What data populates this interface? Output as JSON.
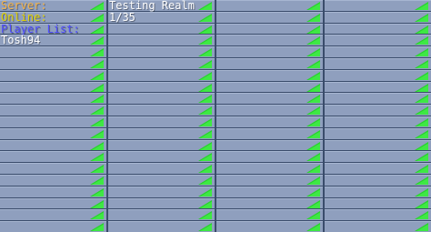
{
  "tab_list": {
    "server_label": "Server:",
    "server_value": "Testing Realm",
    "online_label": "Online:",
    "online_value": "1/35",
    "player_list_label": "Player List:",
    "players": [
      "Tosh94"
    ]
  },
  "colors": {
    "background": "#3f5273",
    "slot": "#8f9fbe",
    "server_label": "#f3b34b",
    "online_label": "#e4d400",
    "player_list_label": "#4e4cff",
    "text": "#ffffff",
    "signal": "#27d22b"
  },
  "icons": {
    "signal": "ping-signal-icon"
  }
}
